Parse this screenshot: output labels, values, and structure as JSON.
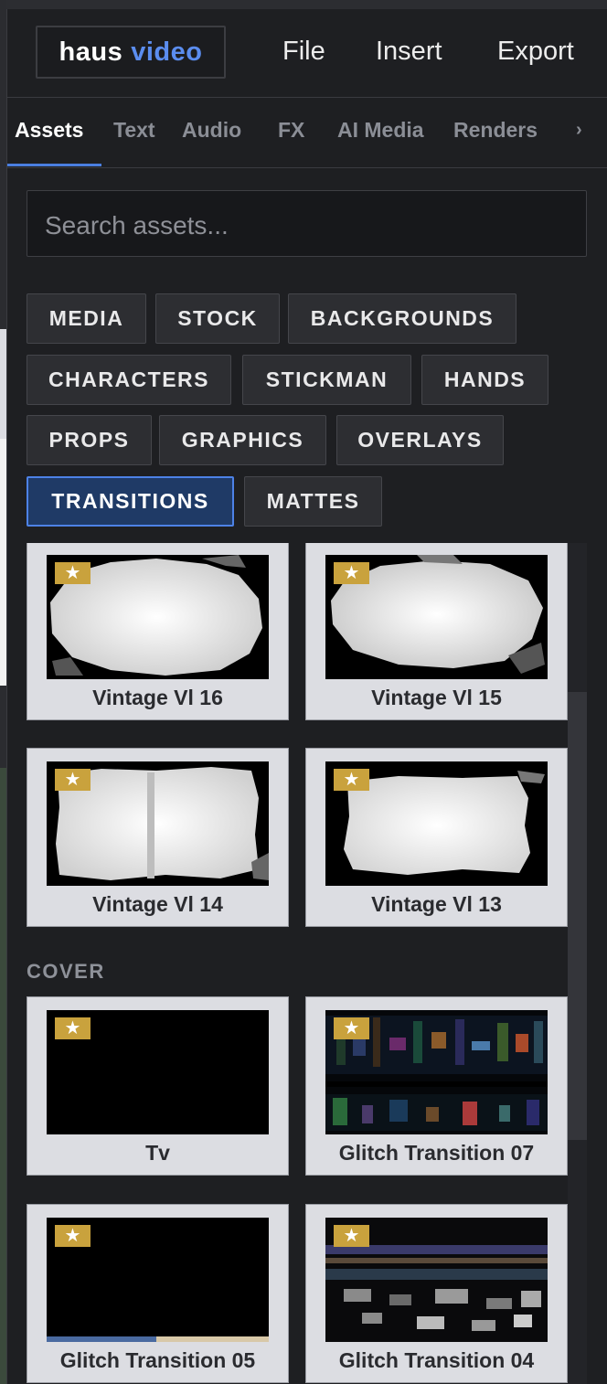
{
  "app": {
    "logo_part1": "haus",
    "logo_part2": "video"
  },
  "menu": {
    "file": "File",
    "insert": "Insert",
    "export": "Export"
  },
  "tabs": {
    "assets": "Assets",
    "text": "Text",
    "audio": "Audio",
    "fx": "FX",
    "ai_media": "AI Media",
    "renders": "Renders",
    "more": "›"
  },
  "search": {
    "placeholder": "Search assets..."
  },
  "categories": {
    "media": "MEDIA",
    "stock": "STOCK",
    "backgrounds": "BACKGROUNDS",
    "characters": "CHARACTERS",
    "stickman": "STICKMAN",
    "hands": "HANDS",
    "props": "PROPS",
    "graphics": "GRAPHICS",
    "overlays": "OVERLAYS",
    "transitions": "TRANSITIONS",
    "mattes": "MATTES",
    "active": "TRANSITIONS"
  },
  "sections": {
    "cover": "COVER"
  },
  "star_glyph": "★",
  "cards": [
    {
      "label": "Vintage Vl 16",
      "thumb": "brush-white"
    },
    {
      "label": "Vintage Vl 15",
      "thumb": "brush-white"
    },
    {
      "label": "Vintage Vl 14",
      "thumb": "brush-white"
    },
    {
      "label": "Vintage Vl 13",
      "thumb": "brush-white"
    },
    {
      "label": "Tv",
      "thumb": "black"
    },
    {
      "label": "Glitch Transition 07",
      "thumb": "glitch"
    },
    {
      "label": "Glitch Transition 05",
      "thumb": "black"
    },
    {
      "label": "Glitch Transition 04",
      "thumb": "glitch"
    }
  ],
  "colors": {
    "accent": "#4a7fe0",
    "logo_blue": "#5b8def",
    "star_bg": "#c9a23d",
    "card_bg": "#dcdde2"
  }
}
